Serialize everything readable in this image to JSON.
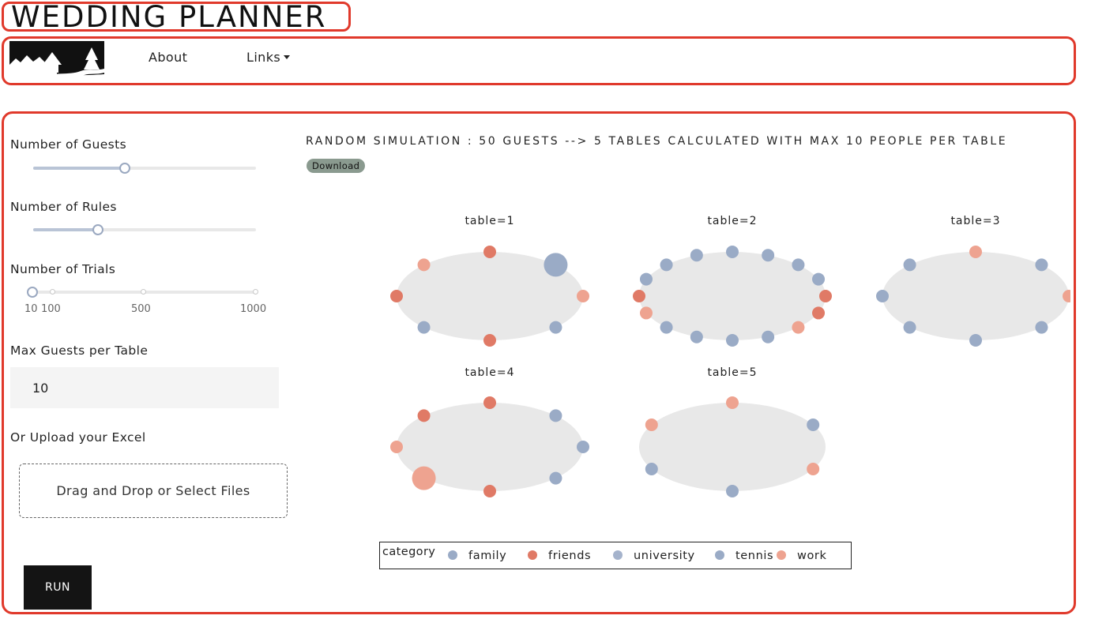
{
  "app": {
    "title": "WEDDING PLANNER"
  },
  "nav": {
    "about": "About",
    "links": "Links"
  },
  "controls": {
    "guests": {
      "label": "Number of Guests",
      "value": 0.41
    },
    "rules": {
      "label": "Number of Rules",
      "value": 0.29
    },
    "trials": {
      "label": "Number of Trials",
      "marks": [
        "10",
        "100",
        "500",
        "1000"
      ],
      "selected": "10"
    },
    "max_guests": {
      "label": "Max Guests per Table",
      "value": "10"
    },
    "upload": {
      "label": "Or Upload your Excel",
      "dropzone": "Drag and Drop or Select Files"
    },
    "run": "RUN"
  },
  "results": {
    "title": "RANDOM SIMULATION : 50 GUESTS --> 5 TABLES CALCULATED WITH MAX 10 PEOPLE PER TABLE",
    "download": "Download"
  },
  "colors": {
    "family": "#9aabc6",
    "friends": "#e07a66",
    "university": "#9aabc6",
    "tennis": "#9aabc6",
    "work": "#eea390",
    "table": "#e8e8e8",
    "accent": "#e0392b"
  },
  "legend": {
    "title": "category",
    "items": [
      {
        "name": "family",
        "color": "#9aabc6"
      },
      {
        "name": "friends",
        "color": "#e07a66"
      },
      {
        "name": "university",
        "color": "#a5b3cc"
      },
      {
        "name": "tennis",
        "color": "#9aabc6"
      },
      {
        "name": "work",
        "color": "#eea390"
      }
    ]
  },
  "chart_data": {
    "type": "scatter",
    "tables": [
      {
        "title": "table=1",
        "guests": [
          "friends",
          "family",
          "work",
          "family",
          "friends",
          "tennis",
          "friends",
          "work"
        ]
      },
      {
        "title": "table=2",
        "guests": [
          "family",
          "family",
          "family",
          "family",
          "friends",
          "friends",
          "work",
          "tennis",
          "tennis",
          "family",
          "family",
          "work",
          "friends",
          "tennis",
          "family",
          "family"
        ]
      },
      {
        "title": "table=3",
        "guests": [
          "work",
          "family",
          "work",
          "tennis",
          "family",
          "family",
          "tennis",
          "tennis"
        ]
      },
      {
        "title": "table=4",
        "guests": [
          "friends",
          "family",
          "family",
          "family",
          "friends",
          "work",
          "work",
          "friends"
        ]
      },
      {
        "title": "table=5",
        "guests": [
          "work",
          "family",
          "work",
          "tennis",
          "family",
          "work"
        ]
      }
    ]
  }
}
